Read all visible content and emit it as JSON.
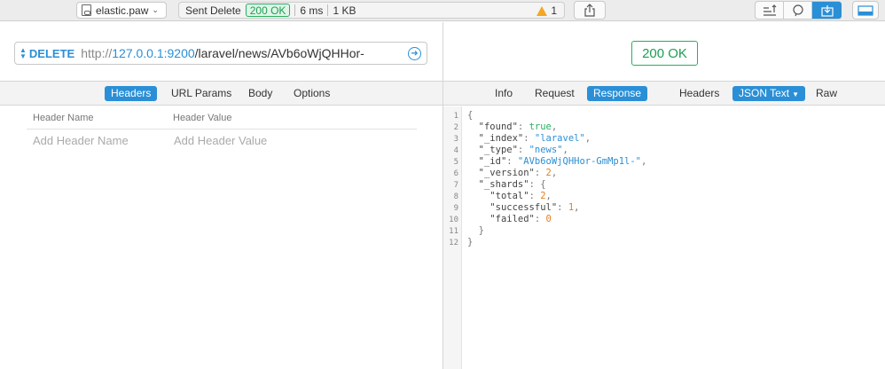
{
  "toolbar": {
    "document_name": "elastic.paw",
    "status_label": "Sent Delete",
    "status_code": "200 OK",
    "duration": "6 ms",
    "size": "1 KB",
    "warning_count": "1"
  },
  "request": {
    "method": "DELETE",
    "url_scheme": "http://",
    "url_host": "127.0.0.1:9200",
    "url_path": "/laravel/news/AVb6oWjQHHor-",
    "tabs": [
      "Headers",
      "URL Params",
      "Body",
      "Options"
    ],
    "active_tab": "Headers",
    "headers_table": {
      "col_name": "Header Name",
      "col_value": "Header Value",
      "name_placeholder": "Add Header Name",
      "value_placeholder": "Add Header Value"
    }
  },
  "response": {
    "status": "200 OK",
    "tabs_left": [
      "Info",
      "Request",
      "Response"
    ],
    "active_tab": "Response",
    "tabs_right": [
      "Headers",
      "JSON Text",
      "Raw"
    ],
    "active_view": "JSON Text",
    "line_numbers": [
      "1",
      "2",
      "3",
      "4",
      "5",
      "6",
      "7",
      "8",
      "9",
      "10",
      "11",
      "12"
    ],
    "json": {
      "found": "true",
      "_index": "\"laravel\"",
      "_type": "\"news\"",
      "_id": "\"AVb6oWjQHHor-GmMp1l-\"",
      "_version": "2",
      "total": "2",
      "successful": "1",
      "failed": "0"
    }
  },
  "colors": {
    "accent": "#2a8fd6",
    "success": "#27ae60",
    "number": "#e67e22",
    "warning": "#f5a623"
  }
}
